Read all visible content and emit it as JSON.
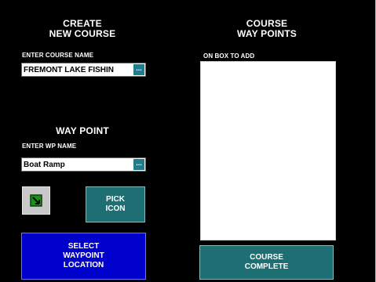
{
  "create_course": {
    "heading_line1": "CREATE",
    "heading_line2": "NEW COURSE",
    "name_label": "ENTER COURSE NAME",
    "name_value": "FREMONT LAKE FISHIN",
    "more_label": "..."
  },
  "waypoint": {
    "heading": "WAY POINT",
    "name_label": "ENTER WP NAME",
    "name_value": "Boat Ramp",
    "more_label": "...",
    "icon_name": "green-arrow-icon",
    "pick_icon_line1": "PICK",
    "pick_icon_line2": "ICON",
    "select_line1": "SELECT",
    "select_line2": "WAYPOINT",
    "select_line3": "LOCATION"
  },
  "course_waypoints": {
    "heading_line1": "COURSE",
    "heading_line2": "WAY POINTS",
    "hint": "ON BOX TO ADD",
    "items": []
  },
  "course_complete": {
    "line1": "COURSE",
    "line2": "COMPLETE"
  },
  "colors": {
    "background": "#000000",
    "teal_button": "#1e6f73",
    "blue_button": "#0000cc",
    "icon_green": "#22aa22"
  }
}
